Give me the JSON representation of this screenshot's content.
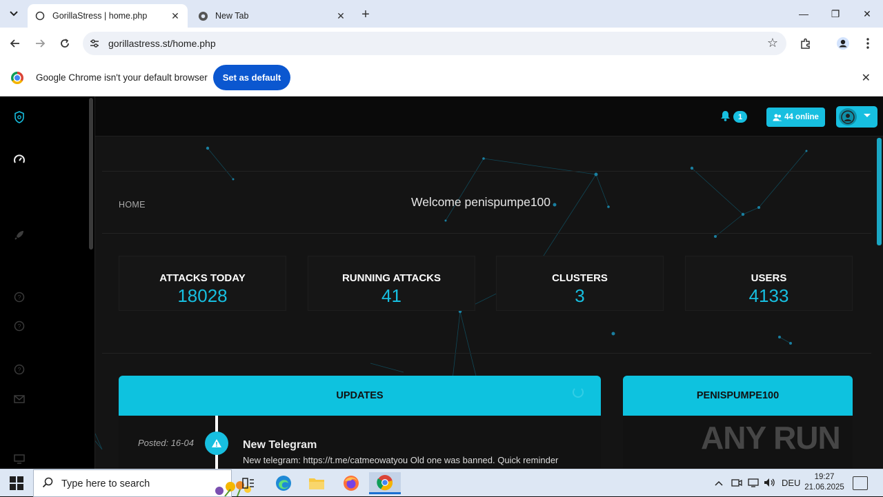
{
  "browser": {
    "tabs": [
      {
        "title": "GorillaStress | home.php",
        "active": true
      },
      {
        "title": "New Tab",
        "active": false
      }
    ],
    "url": "gorillastress.st/home.php",
    "infobar": {
      "message": "Google Chrome isn't your default browser",
      "button": "Set as default"
    }
  },
  "site": {
    "notifications_count": "1",
    "online_label": "44 online",
    "breadcrumb": "HOME",
    "welcome": "Welcome penispumpe100",
    "stats": [
      {
        "label": "ATTACKS TODAY",
        "value": "18028"
      },
      {
        "label": "RUNNING ATTACKS",
        "value": "41"
      },
      {
        "label": "CLUSTERS",
        "value": "3"
      },
      {
        "label": "USERS",
        "value": "4133"
      }
    ],
    "updates": {
      "title": "UPDATES",
      "posts": [
        {
          "posted": "Posted: 16-04",
          "title": "New Telegram",
          "body": "New telegram: https://t.me/catmeowatyou Old one was banned. Quick reminder"
        }
      ]
    },
    "user_panel": {
      "title": "PENISPUMPE100"
    },
    "accent_color": "#17bfe0"
  },
  "watermark": "ANY RUN",
  "taskbar": {
    "search_placeholder": "Type here to search",
    "language": "DEU",
    "time": "19:27",
    "date": "21.06.2025"
  }
}
